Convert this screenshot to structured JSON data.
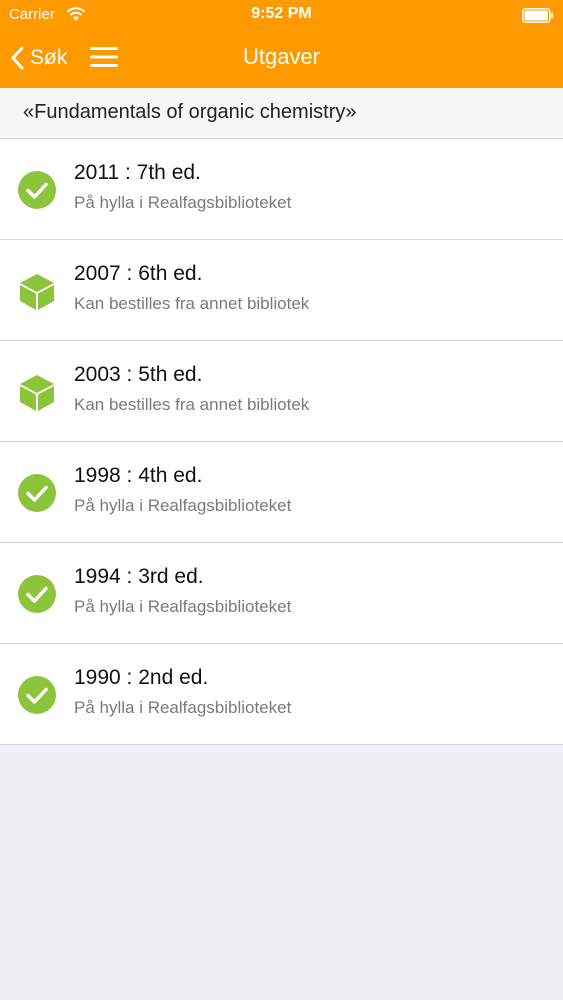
{
  "status_bar": {
    "carrier": "Carrier",
    "time": "9:52 PM"
  },
  "nav": {
    "back_label": "Søk",
    "title": "Utgaver"
  },
  "section": {
    "title": "«Fundamentals of organic chemistry»"
  },
  "colors": {
    "accent": "#ff9900",
    "available_green": "#8cc43c",
    "orderable_green": "#8cc43c"
  },
  "editions": [
    {
      "title": "2011 : 7th ed.",
      "status": "På hylla i Realfagsbiblioteket",
      "icon": "check-circle-icon"
    },
    {
      "title": "2007 : 6th ed.",
      "status": "Kan bestilles fra annet bibliotek",
      "icon": "package-icon"
    },
    {
      "title": "2003 : 5th ed.",
      "status": "Kan bestilles fra annet bibliotek",
      "icon": "package-icon"
    },
    {
      "title": "1998 : 4th ed.",
      "status": "På hylla i Realfagsbiblioteket",
      "icon": "check-circle-icon"
    },
    {
      "title": "1994 : 3rd ed.",
      "status": "På hylla i Realfagsbiblioteket",
      "icon": "check-circle-icon"
    },
    {
      "title": "1990 : 2nd ed.",
      "status": "På hylla i Realfagsbiblioteket",
      "icon": "check-circle-icon"
    }
  ]
}
